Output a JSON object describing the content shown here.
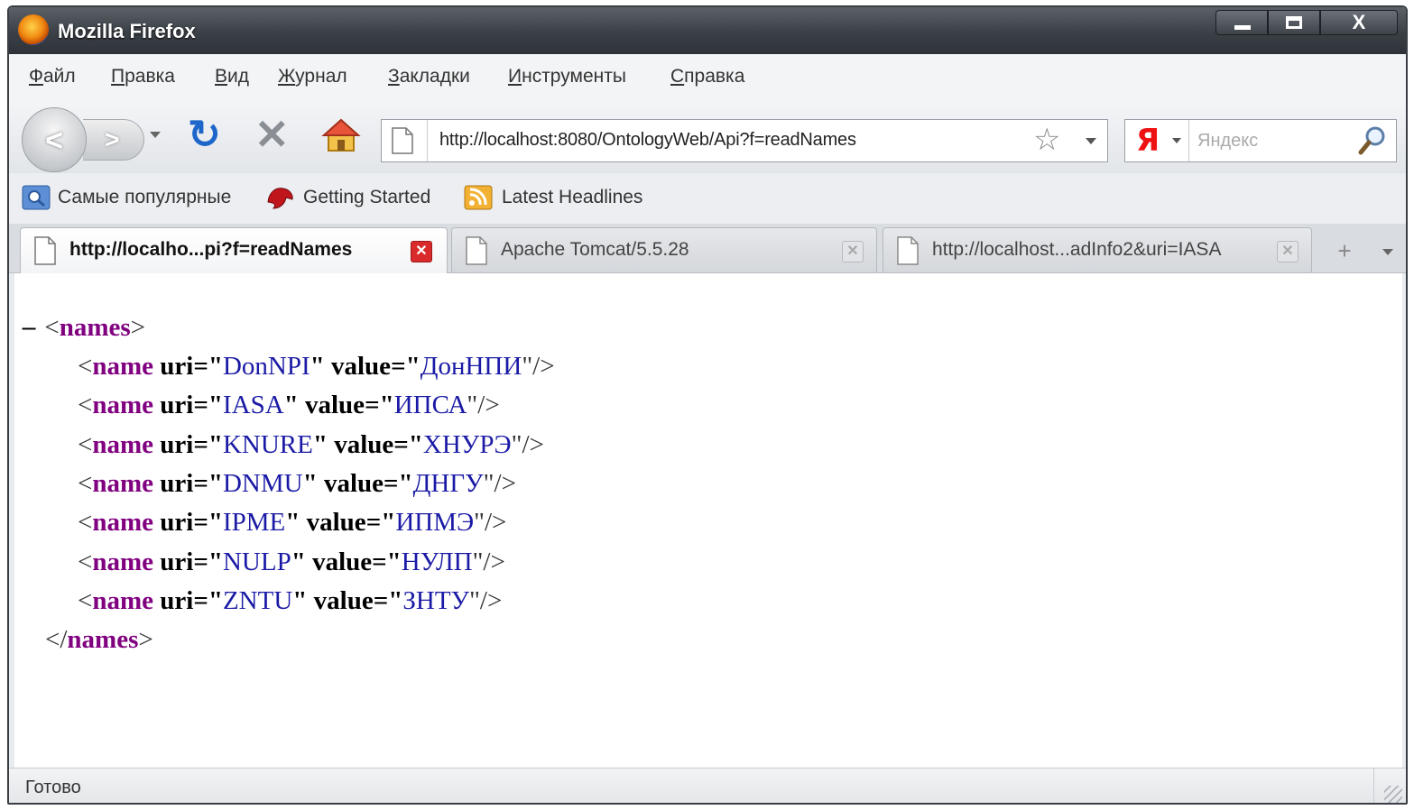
{
  "window": {
    "title": "Mozilla Firefox",
    "controls": {
      "minimize": "",
      "maximize": "",
      "close": "X"
    }
  },
  "menu": [
    "Файл",
    "Правка",
    "Вид",
    "Журнал",
    "Закладки",
    "Инструменты",
    "Справка"
  ],
  "nav": {
    "back": "<",
    "forward": ">",
    "url": "http://localhost:8080/OntologyWeb/Api?f=readNames",
    "search_placeholder": "Яндекс",
    "search_engine_glyph": "Я"
  },
  "bookmarks": [
    "Самые популярные",
    "Getting Started",
    "Latest Headlines"
  ],
  "tabs": [
    {
      "title": "http://localho...pi?f=readNames",
      "active": true
    },
    {
      "title": "Apache Tomcat/5.5.28",
      "active": false
    },
    {
      "title": "http://localhost...adInfo2&uri=IASA",
      "active": false
    }
  ],
  "tab_controls": {
    "new_tab": "+"
  },
  "xml": {
    "collapse": "−",
    "root_tag": "names",
    "attr_uri": "uri",
    "attr_value": "value",
    "items": [
      {
        "tag": "name",
        "uri": "DonNPI",
        "value": "ДонНПИ"
      },
      {
        "tag": "name",
        "uri": "IASA",
        "value": "ИПСА"
      },
      {
        "tag": "name",
        "uri": "KNURE",
        "value": "ХНУРЭ"
      },
      {
        "tag": "name",
        "uri": "DNMU",
        "value": "ДНГУ"
      },
      {
        "tag": "name",
        "uri": "IPME",
        "value": "ИПМЭ"
      },
      {
        "tag": "name",
        "uri": "NULP",
        "value": "НУЛП"
      },
      {
        "tag": "name",
        "uri": "ZNTU",
        "value": "ЗНТУ"
      }
    ]
  },
  "status": "Готово",
  "colors": {
    "tag": "#800080",
    "value": "#1a1aa6",
    "reload": "#1e66c9",
    "close_tab": "#d92b2b"
  },
  "icons": [
    "firefox-logo-icon",
    "reload-icon",
    "stop-icon",
    "home-icon",
    "page-icon",
    "star-icon",
    "yandex-icon",
    "magnifier-icon",
    "most-visited-icon",
    "getting-started-icon",
    "rss-feed-icon",
    "tab-close-icon",
    "new-tab-icon"
  ]
}
